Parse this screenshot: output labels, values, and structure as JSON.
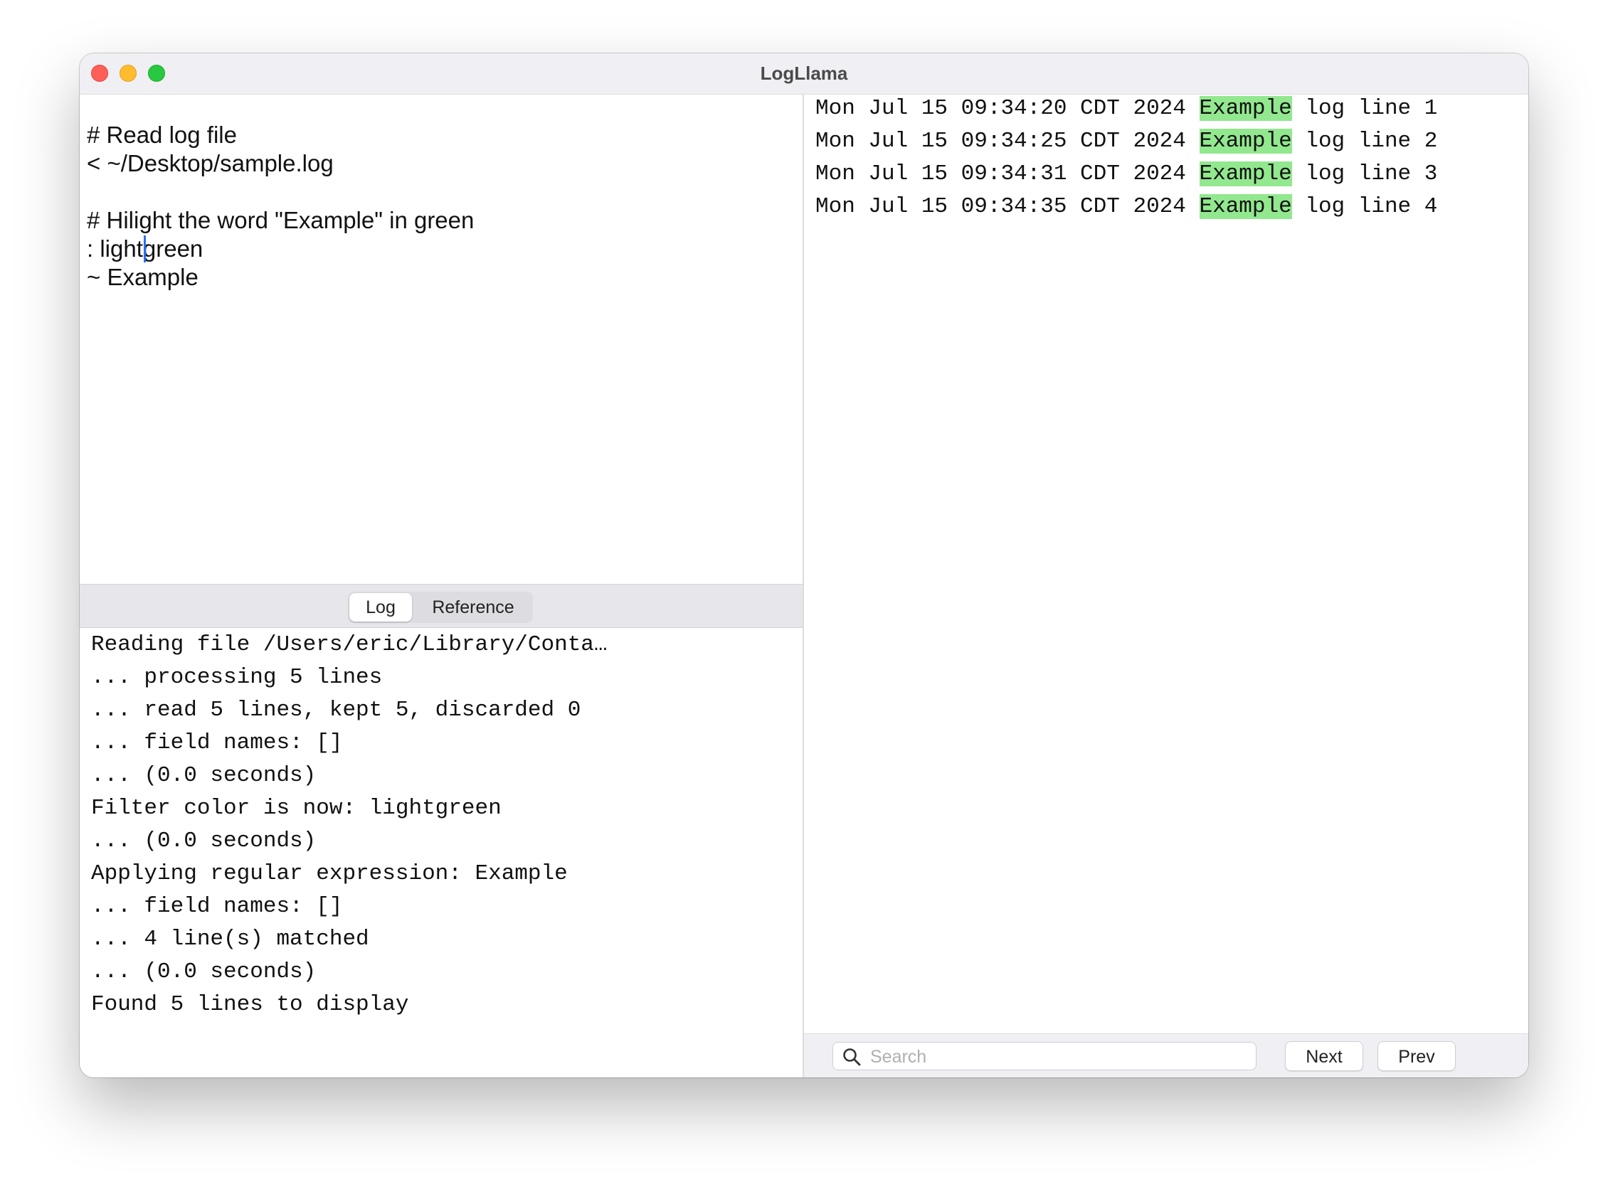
{
  "window": {
    "title": "LogLlama"
  },
  "editor": {
    "lines": [
      "# Read log file",
      "< ~/Desktop/sample.log",
      "",
      "# Hilight the word \"Example\" in green",
      ": lightgreen",
      "~ Example"
    ]
  },
  "tabs": {
    "log_label": "Log",
    "reference_label": "Reference"
  },
  "console": {
    "lines": [
      "Reading file /Users/eric/Library/Conta…",
      "... processing 5 lines",
      "... read 5 lines, kept 5, discarded 0",
      "... field names: []",
      "... (0.0 seconds)",
      "Filter color is now: lightgreen",
      "... (0.0 seconds)",
      "Applying regular expression: Example",
      "... field names: []",
      "... 4 line(s) matched",
      "... (0.0 seconds)",
      "Found 5 lines to display"
    ]
  },
  "log_view": {
    "highlight_color": "#92e88e",
    "rows": [
      {
        "prefix": "Mon Jul 15 09:34:20 CDT 2024 ",
        "match": "Example",
        "suffix": " log line 1"
      },
      {
        "prefix": "Mon Jul 15 09:34:25 CDT 2024 ",
        "match": "Example",
        "suffix": " log line 2"
      },
      {
        "prefix": "Mon Jul 15 09:34:31 CDT 2024 ",
        "match": "Example",
        "suffix": " log line 3"
      },
      {
        "prefix": "Mon Jul 15 09:34:35 CDT 2024 ",
        "match": "Example",
        "suffix": " log line 4"
      }
    ]
  },
  "search": {
    "placeholder": "Search",
    "icon": "magnifying-glass",
    "next_label": "Next",
    "prev_label": "Prev"
  }
}
